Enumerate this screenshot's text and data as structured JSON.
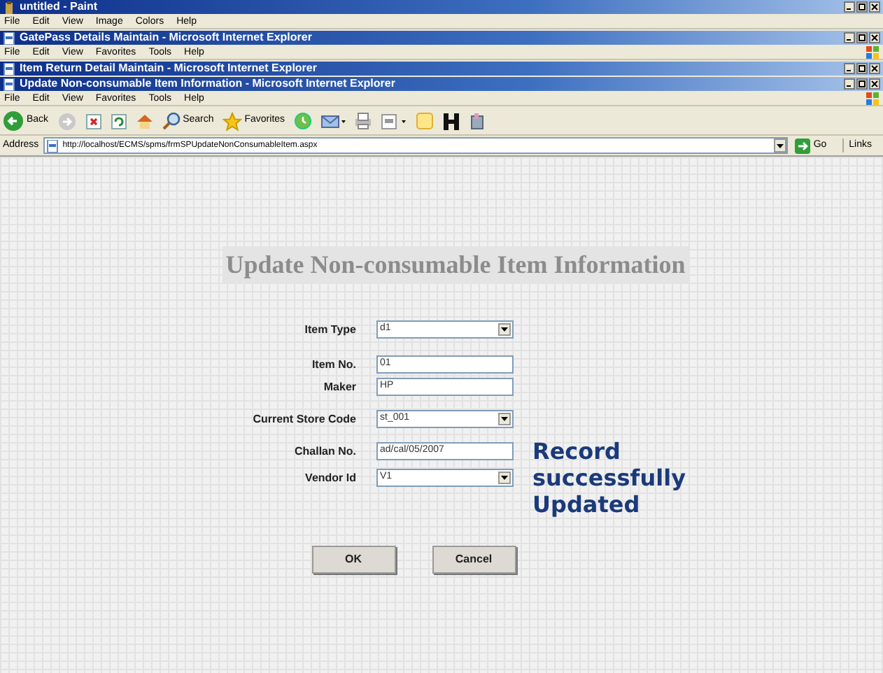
{
  "windows": [
    {
      "title": "untitled - Paint",
      "menu": [
        "File",
        "Edit",
        "View",
        "Image",
        "Colors",
        "Help"
      ],
      "logo": false
    },
    {
      "title": "GatePass Details Maintain - Microsoft Internet Explorer",
      "menu": [
        "File",
        "Edit",
        "View",
        "Favorites",
        "Tools",
        "Help"
      ],
      "logo": true
    },
    {
      "title": "Item Return Detail Maintain - Microsoft Internet Explorer"
    },
    {
      "title": "Update Non-consumable Item Information - Microsoft Internet Explorer",
      "menu": [
        "File",
        "Edit",
        "View",
        "Favorites",
        "Tools",
        "Help"
      ],
      "logo": true
    }
  ],
  "toolbar": {
    "back": "Back",
    "search": "Search",
    "favorites": "Favorites"
  },
  "address": {
    "label": "Address",
    "url": "http://localhost/ECMS/spms/frmSPUpdateNonConsumableItem.aspx",
    "go": "Go",
    "links": "Links"
  },
  "page": {
    "heading": "Update Non-consumable Item Information",
    "fields": [
      {
        "label": "Item Type",
        "kind": "select",
        "value": "d1"
      },
      {
        "label": "Item No.",
        "kind": "text",
        "value": "01"
      },
      {
        "label": "Maker",
        "kind": "text",
        "value": "HP"
      },
      {
        "label": "Current Store Code",
        "kind": "select",
        "value": "st_001"
      },
      {
        "label": "Challan No.",
        "kind": "text",
        "value": "ad/cal/05/2007"
      },
      {
        "label": "Vendor Id",
        "kind": "select",
        "value": "V1"
      }
    ],
    "message": "Record successfully Updated",
    "buttons": [
      "OK",
      "Cancel"
    ]
  }
}
